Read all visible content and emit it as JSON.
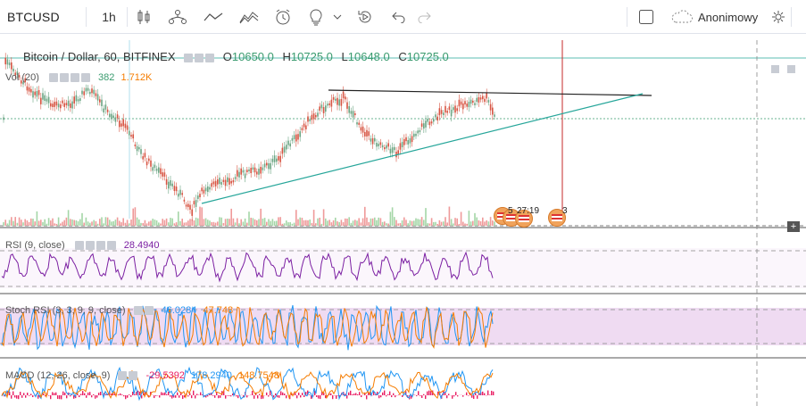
{
  "toolbar": {
    "symbol": "BTCUSD",
    "interval": "1h",
    "anon_label": "Anonimowy"
  },
  "legend": {
    "title": "Bitcoin / Dollar, 60, BITFINEX",
    "o_label": "O",
    "o_value": "10650.0",
    "h_label": "H",
    "h_value": "10725.0",
    "l_label": "L",
    "l_value": "10648.0",
    "c_label": "C",
    "c_value": "10725.0"
  },
  "vol": {
    "label": "Vol (20)",
    "v1": "382",
    "v2": "1.712K"
  },
  "events": {
    "count_a": "5",
    "time_a": "27:19",
    "count_b": "3"
  },
  "rsi": {
    "label": "RSI (9, close)",
    "value": "28.4940"
  },
  "stoch": {
    "label": "Stoch RSI (3, 3, 9, 9, close)",
    "k": "46.0284",
    "d": "47.748"
  },
  "macd": {
    "label": "MACD (12, 26, close, 9)",
    "hist": "-29.5392",
    "macd": "178.2940",
    "signal": "148.7548"
  },
  "colors": {
    "up": "#6ba583",
    "down": "#d75442",
    "rsi": "#7b1fa2",
    "stoch_k": "#2196f3",
    "stoch_d": "#f57c00",
    "macd_line": "#2196f3",
    "macd_signal": "#f57c00",
    "macd_hist": "#e91e63",
    "trend_up": "#26a69a",
    "accent": "#3a9b6f"
  },
  "icons": [
    "candles-icon",
    "indicators-icon",
    "line-draw-icon",
    "compare-icon",
    "alert-icon",
    "idea-icon",
    "replay-icon",
    "undo-icon",
    "redo-icon",
    "layout-square-icon",
    "cloud-icon",
    "gear-icon"
  ]
}
